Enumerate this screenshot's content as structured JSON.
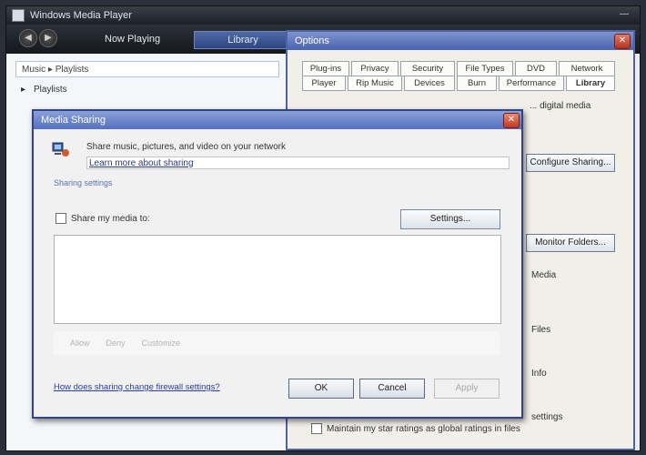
{
  "wmp": {
    "title": "Windows Media Player",
    "tabs": [
      "Now Playing",
      "Library"
    ],
    "library": {
      "search": "Music ▸ Playlists",
      "row_label": "Playlists"
    }
  },
  "options": {
    "title": "Options",
    "tabs_row1": [
      "Plug-ins",
      "Privacy",
      "Security",
      "File Types",
      "DVD",
      "Network"
    ],
    "tabs_row2": [
      "Player",
      "Rip Music",
      "Devices",
      "Burn",
      "Performance",
      "Library"
    ],
    "line1": "... digital media",
    "btn1": "Configure Sharing...",
    "btn2": "Monitor Folders...",
    "label1": "Media",
    "label2": "Files",
    "label3": "Info",
    "footer_line": "settings",
    "checkbox": "Maintain my star ratings as global ratings in files"
  },
  "share": {
    "title": "Media Sharing",
    "heading": "Share music, pictures, and video on your network",
    "field": "Learn more about sharing",
    "sub": "Sharing settings",
    "checkbox": "Share my media to:",
    "settings_button": "Settings...",
    "grey_items": [
      "Allow",
      "Deny",
      "Customize"
    ],
    "link": "How does sharing change firewall settings?",
    "ok": "OK",
    "cancel": "Cancel",
    "apply": "Apply"
  }
}
